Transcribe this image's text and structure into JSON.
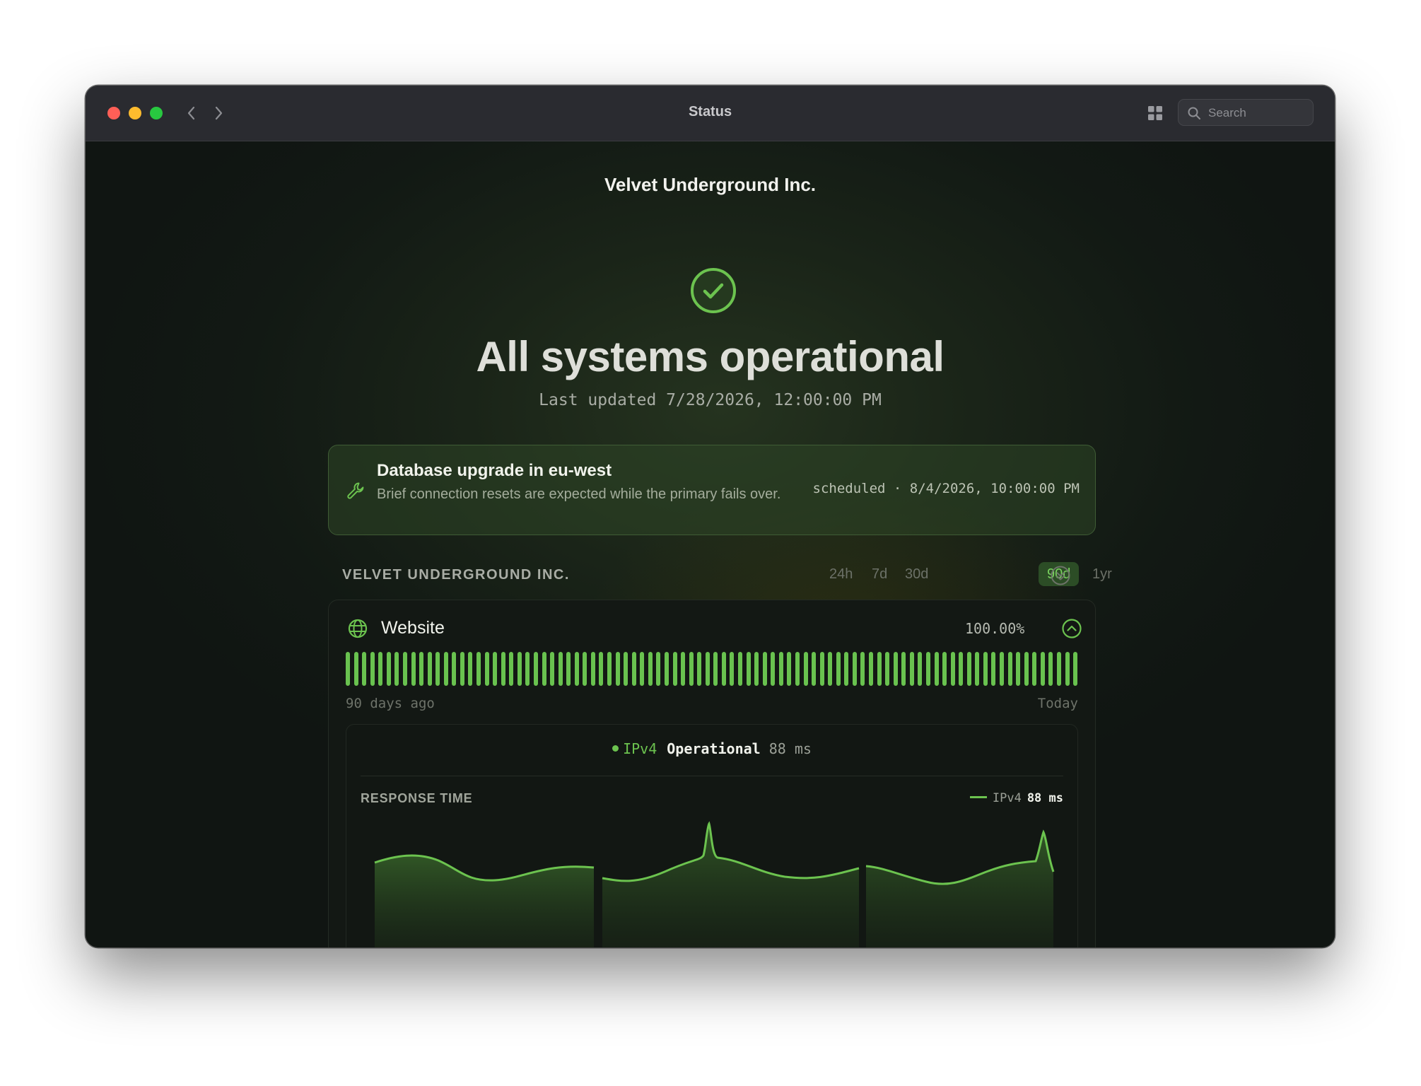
{
  "window": {
    "title": "Status",
    "search": {
      "placeholder": "Search"
    }
  },
  "page": {
    "org_name": "Velvet Underground Inc.",
    "headline": "All systems operational",
    "last_updated": "Last updated 7/28/2026, 12:00:00 PM"
  },
  "notice": {
    "title": "Database upgrade in eu-west",
    "description": "Brief connection resets are expected while the primary fails over.",
    "meta": "scheduled · 8/4/2026, 10:00:00 PM"
  },
  "section": {
    "title": "VELVET UNDERGROUND INC.",
    "ranges": [
      "24h",
      "7d",
      "30d",
      "90d",
      "1yr"
    ],
    "active_range": "90d"
  },
  "service": {
    "name": "Website",
    "uptime": "100.00%",
    "bar_count": 90,
    "range_start": "90 days ago",
    "range_end": "Today",
    "protocol": {
      "name": "IPv4",
      "state": "Operational",
      "latency": "88 ms"
    },
    "response_time": {
      "title": "RESPONSE TIME",
      "legend_name": "IPv4",
      "legend_value": "88 ms"
    }
  },
  "colors": {
    "accent": "#6cc34f",
    "bar": "#69c24f",
    "background": "#121814"
  }
}
